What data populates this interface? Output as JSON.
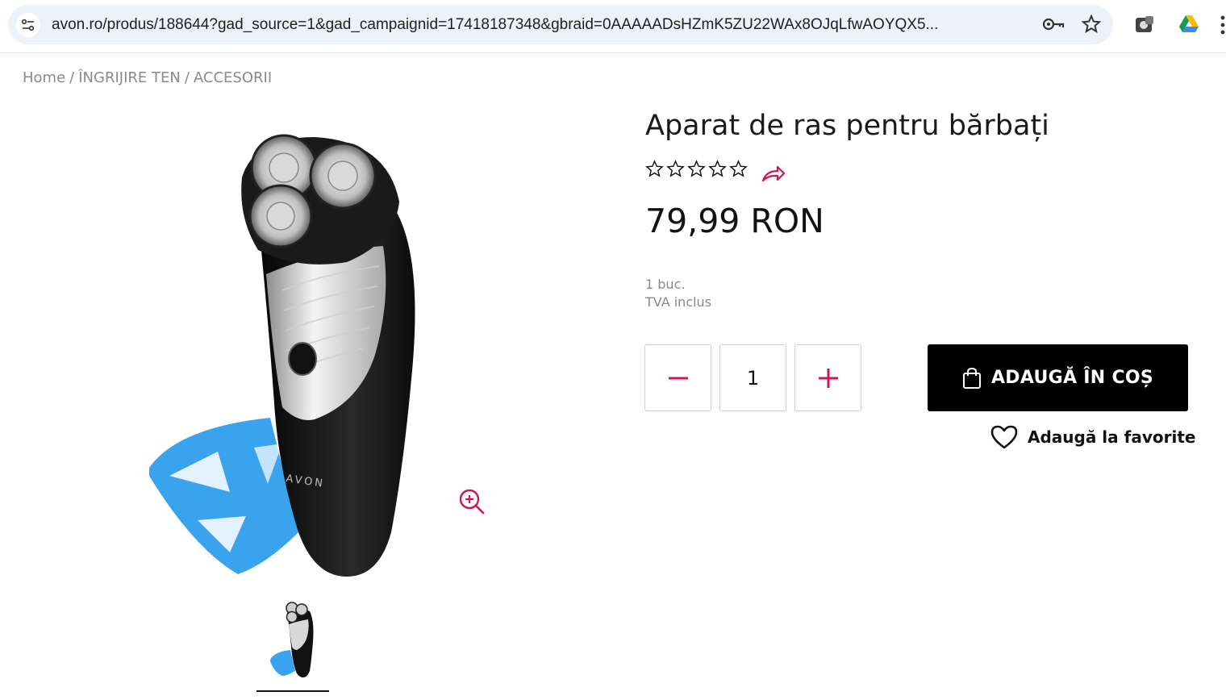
{
  "browser": {
    "url": "avon.ro/produs/188644?gad_source=1&gad_campaignid=17418187348&gbraid=0AAAAADsHZmK5ZU22WAx8OJqLfwAOYQX5..."
  },
  "breadcrumb": {
    "items": [
      "Home",
      "ÎNGRIJIRE TEN",
      "ACCESORII"
    ],
    "separator": "/"
  },
  "product": {
    "title": "Aparat de ras pentru bărbați",
    "rating": 0,
    "rating_max": 5,
    "price": "79,99 RON",
    "unit": "1 buc.",
    "vat": "TVA inclus",
    "brand_print": "AVON"
  },
  "cart": {
    "quantity": "1",
    "add_to_cart_label": "ADAUGĂ ÎN COȘ",
    "add_to_favorites_label": "Adaugă la favorite"
  },
  "colors": {
    "accent": "#c8175d",
    "button_bg": "#000000",
    "shaver_guard": "#3aa3ee"
  }
}
